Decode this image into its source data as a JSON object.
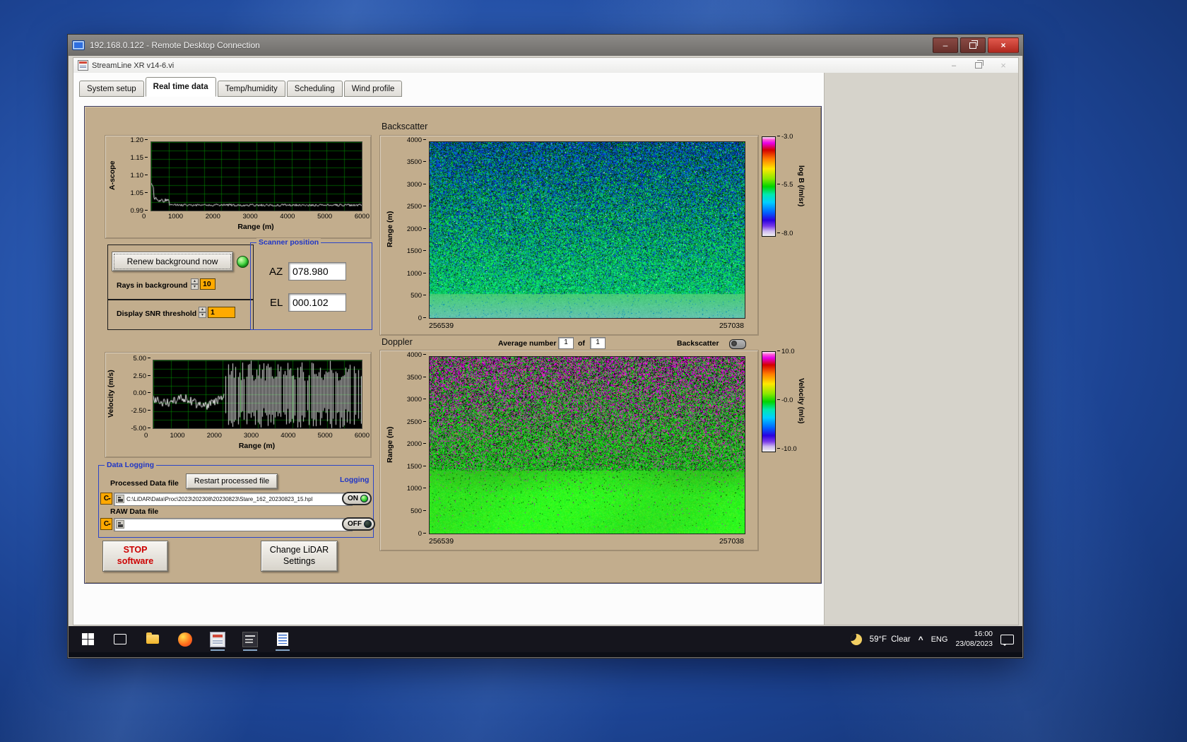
{
  "rdp": {
    "title": "192.168.0.122 - Remote Desktop Connection"
  },
  "app": {
    "title": "StreamLine XR v14-6.vi",
    "tabs": [
      "System setup",
      "Real time data",
      "Temp/humidity",
      "Scheduling",
      "Wind profile"
    ],
    "active_tab": "Real time data"
  },
  "plots": {
    "ascope": {
      "ylabel": "A-scope",
      "xlabel": "Range (m)",
      "yticks": [
        "1.20",
        "1.15",
        "1.10",
        "1.05",
        "0.99"
      ],
      "xticks": [
        "0",
        "1000",
        "2000",
        "3000",
        "4000",
        "5000",
        "6000"
      ]
    },
    "velocity": {
      "ylabel": "Velocity (m/s)",
      "xlabel": "Range (m)",
      "yticks": [
        "5.00",
        "2.50",
        "0.00",
        "-2.50",
        "-5.00"
      ],
      "xticks": [
        "0",
        "1000",
        "2000",
        "3000",
        "4000",
        "5000",
        "6000"
      ]
    },
    "backscatter": {
      "title": "Backscatter",
      "ylabel": "Range (m)",
      "yticks": [
        "4000",
        "3500",
        "3000",
        "2500",
        "2000",
        "1500",
        "1000",
        "500",
        "0"
      ],
      "x_start": "256539",
      "x_end": "257038",
      "cb_ticks": [
        "-3.0",
        "-5.5",
        "-8.0"
      ],
      "cb_label": "log B (/m/sr)"
    },
    "doppler": {
      "title": "Doppler",
      "avg_label": "Average number",
      "avg_value": "1",
      "of_label": "of",
      "of_count": "1",
      "toggle_label": "Backscatter",
      "ylabel": "Range (m)",
      "yticks": [
        "4000",
        "3500",
        "3000",
        "2500",
        "2000",
        "1500",
        "1000",
        "500",
        "0"
      ],
      "x_start": "256539",
      "x_end": "257038",
      "cb_ticks": [
        "10.0",
        "-0.0",
        "-10.0"
      ],
      "cb_label": "Velocity (m/s)"
    }
  },
  "controls": {
    "renew_button": "Renew background now",
    "rays_label": "Rays in background",
    "rays_value": "10",
    "snr_label": "Display SNR threshold",
    "snr_value": "1"
  },
  "scanner": {
    "title": "Scanner position",
    "az_label": "AZ",
    "az_value": "078.980",
    "el_label": "EL",
    "el_value": "000.102"
  },
  "logging": {
    "title": "Data Logging",
    "processed_label": "Processed Data file",
    "restart_button": "Restart processed file",
    "drive_label": "C",
    "processed_path": "C:\\LiDAR\\Data\\Proc\\2023\\202308\\20230823\\Stare_162_20230823_15.hpl",
    "raw_label": "RAW Data file",
    "raw_path": "",
    "logging_label": "Logging",
    "on_label": "ON",
    "off_label": "OFF"
  },
  "actions": {
    "stop_line1": "STOP",
    "stop_line2": "software",
    "settings_line1": "Change LiDAR",
    "settings_line2": "Settings"
  },
  "taskbar": {
    "temp": "59°F",
    "condition": "Clear",
    "caret": "^",
    "language": "ENG",
    "time": "16:00",
    "date": "23/08/2023"
  }
}
